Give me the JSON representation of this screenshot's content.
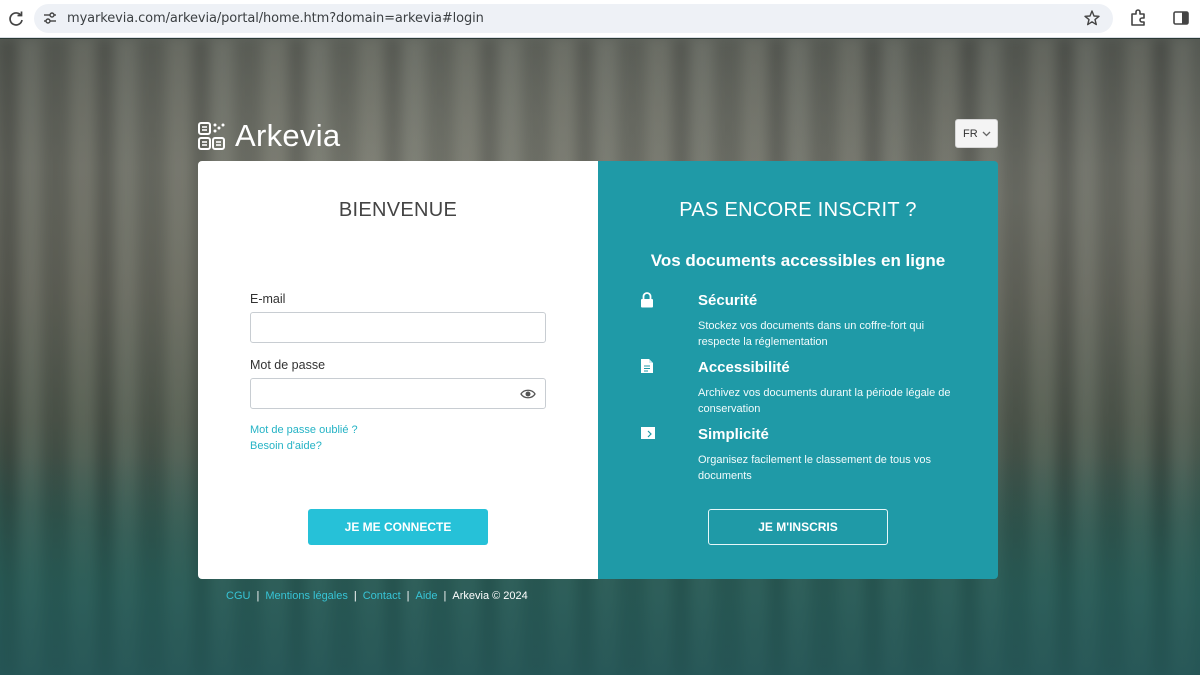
{
  "browser": {
    "url": "myarkevia.com/arkevia/portal/home.htm?domain=arkevia#login"
  },
  "brand": {
    "name": "Arkevia"
  },
  "language": {
    "selected": "FR"
  },
  "login": {
    "title": "BIENVENUE",
    "email_label": "E-mail",
    "email_value": "",
    "password_label": "Mot de passe",
    "password_value": "",
    "forgot_link": "Mot de passe oublié ?",
    "help_link": "Besoin d'aide?",
    "submit_label": "JE ME CONNECTE"
  },
  "signup": {
    "title": "PAS ENCORE INSCRIT ?",
    "subtitle": "Vos documents accessibles en ligne",
    "features": [
      {
        "icon": "lock-icon",
        "title": "Sécurité",
        "desc": "Stockez vos documents dans un coffre-fort qui respecte la réglementation"
      },
      {
        "icon": "document-icon",
        "title": "Accessibilité",
        "desc": "Archivez vos documents durant la période légale de conservation"
      },
      {
        "icon": "folder-icon",
        "title": "Simplicité",
        "desc": "Organisez facilement le classement de tous vos documents"
      }
    ],
    "button_label": "JE M'INSCRIS"
  },
  "footer": {
    "links": [
      "CGU",
      "Mentions légales",
      "Contact",
      "Aide"
    ],
    "copyright": "Arkevia © 2024"
  },
  "colors": {
    "teal_panel": "#1f9aa7",
    "login_button": "#26c1d8",
    "link": "#25b3c5"
  }
}
